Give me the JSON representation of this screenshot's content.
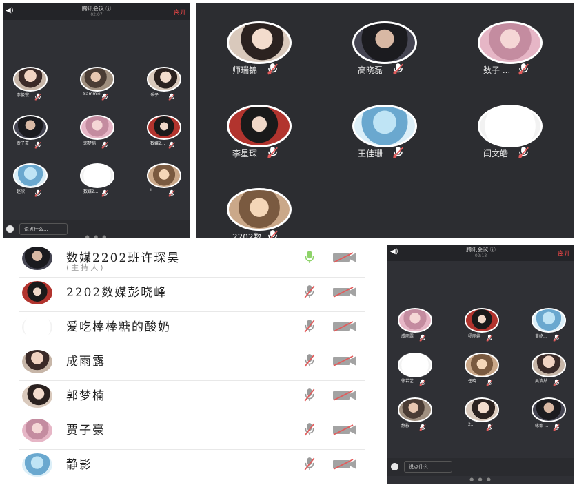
{
  "panel1": {
    "header": {
      "speaker_icon": "speaker-icon",
      "title": "腾讯会议 ⓘ",
      "time": "02:07",
      "leave": "离开"
    },
    "participants": [
      "李俊宏",
      "Sammie",
      "乐子...",
      "贾子豪",
      "郭梦楠",
      "数媒2...",
      "赵欣",
      "数媒2...",
      "L..."
    ],
    "input_placeholder": "说点什么...",
    "page_dots": "● ● ●"
  },
  "panel2": {
    "participants": [
      "师瑞锦",
      "高晓磊",
      "数子 ...",
      "李星琛",
      "王佳珊",
      "闫文皓",
      "2202数..."
    ]
  },
  "panel3": {
    "header": {
      "speaker_icon": "speaker-icon",
      "title": "腾讯会议 ⓘ",
      "time": "02:13",
      "leave": "离开"
    },
    "participants": [
      "成雨露",
      "杨丽婷",
      "黄屹...",
      "徐若艺",
      "任晓...",
      "吴洁然",
      "静影",
      "2...",
      "咏都 ..."
    ],
    "input_placeholder": "说点什么...",
    "page_dots": "● ● ●"
  },
  "list": {
    "rows": [
      {
        "name": "数媒2202班许琛昊",
        "sub": "(主持人)",
        "mic_on": true
      },
      {
        "name": "2202数媒彭晓峰",
        "sub": "",
        "mic_on": false
      },
      {
        "name": "爱吃棒棒糖的酸奶",
        "sub": "",
        "mic_on": false
      },
      {
        "name": "成雨露",
        "sub": "",
        "mic_on": false
      },
      {
        "name": "郭梦楠",
        "sub": "",
        "mic_on": false
      },
      {
        "name": "贾子豪",
        "sub": "",
        "mic_on": false
      },
      {
        "name": "静影",
        "sub": "",
        "mic_on": false
      }
    ]
  },
  "colors": {
    "mic_on": "#8ed36a",
    "mic_muted": "#e35b5b",
    "leave": "#ff4a4a",
    "panel_bg": "#2f3035"
  }
}
